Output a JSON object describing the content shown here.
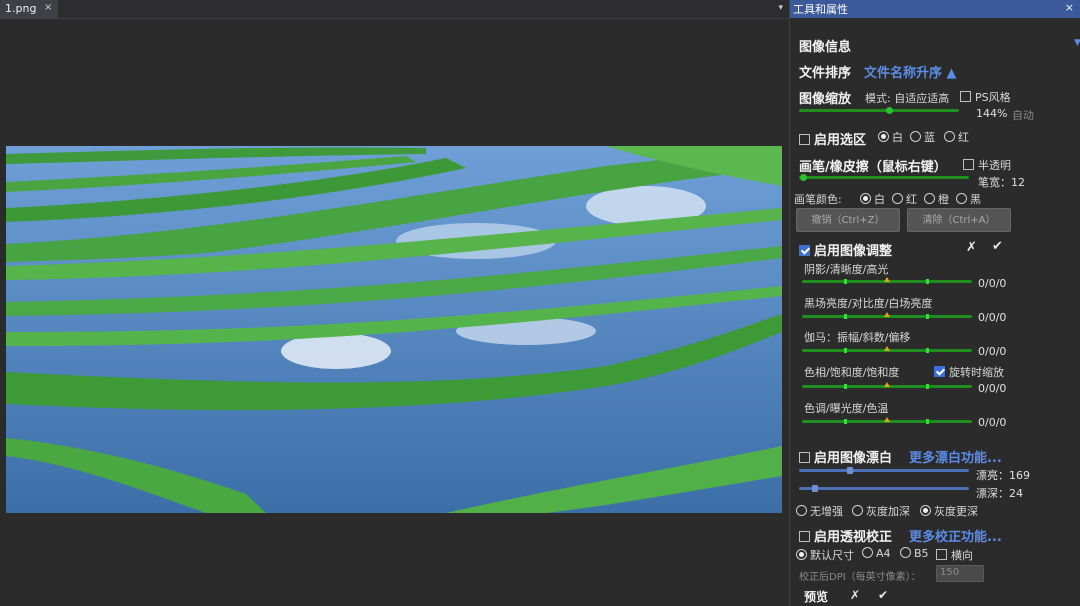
{
  "doc": {
    "tab_name": "1.png",
    "tab_close": "×",
    "tab_menu": "▾"
  },
  "panel": {
    "title": "工具和属性",
    "close": "×",
    "image_info": "图像信息",
    "sort": {
      "label": "文件排序",
      "value": "文件名称升序 ▲"
    },
    "zoom": {
      "label": "图像缩放",
      "mode": "模式: 自适应适高",
      "ps_style": "PS风格",
      "percent": "144%",
      "auto": "自动",
      "level": 0.56
    },
    "selection": {
      "label": "启用选区",
      "options": [
        "白",
        "蓝",
        "红"
      ],
      "selected": 0
    },
    "brush": {
      "label": "画笔/橡皮擦（鼠标右键）",
      "semi": "半透明",
      "size_label": "笔宽：12",
      "size": 12
    },
    "brush_color": {
      "label": "画笔颜色:",
      "options": [
        "白",
        "红",
        "橙",
        "黑"
      ],
      "selected": 0
    },
    "buttons": {
      "undo": "撤销（Ctrl+Z）",
      "reset": "清除（Ctrl+A）"
    },
    "adjust": {
      "label": "启用图像调整",
      "cancel": "✗",
      "ok": "✔",
      "rows": [
        {
          "label": "阴影/清晰度/高光",
          "value": "0/0/0"
        },
        {
          "label": "黑场亮度/对比度/白场亮度",
          "value": "0/0/0"
        },
        {
          "label": "伽马：振幅/斜数/偏移",
          "value": "0/0/0"
        },
        {
          "label": "色相/饱和度/饱和度",
          "value": "0/0/0",
          "extra": "旋转时缩放"
        },
        {
          "label": "色调/曝光度/色温",
          "value": "0/0/0"
        }
      ]
    },
    "whiten": {
      "label": "启用图像漂白",
      "more": "更多漂白功能...",
      "intensity_label": "漂亮：169",
      "depth_label": "漂深：24",
      "intensity": 169,
      "depth": 24,
      "modes": [
        "无增强",
        "灰度加深",
        "灰度更深"
      ],
      "selected": 2
    },
    "perspective": {
      "label": "启用透视校正",
      "more": "更多校正功能...",
      "sizes": [
        "默认尺寸",
        "A4",
        "B5"
      ],
      "selected": 0,
      "landscape": "横向",
      "dpi_label": "校正后DPI（每英寸像素）：",
      "dpi_value": "150",
      "preview": "预览",
      "cancel": "✗",
      "ok": "✔"
    }
  },
  "colors": {
    "accent_blue": "#5b8de8",
    "slider_green": "#1e8f1e",
    "header_blue": "#3c5a9a"
  }
}
